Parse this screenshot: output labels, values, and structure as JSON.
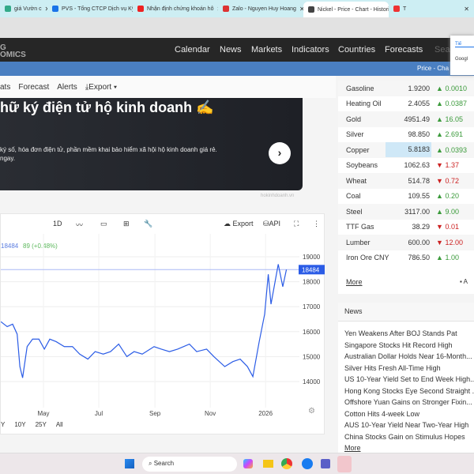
{
  "browser": {
    "tabs": [
      {
        "title": "giá Vườn c",
        "color": "#3a8"
      },
      {
        "title": "PVS - Tổng CTCP Dịch vụ Kỹ thu",
        "color": "#1a73e8"
      },
      {
        "title": "Nhận định chứng khoán hô",
        "color": "#e22"
      },
      {
        "title": "Zalo - Nguyen Huy Hoang",
        "color": "#d33"
      },
      {
        "title": "Nickel - Price - Chart - Historic",
        "color": "#444"
      },
      {
        "title": "T",
        "color": "#e33"
      }
    ]
  },
  "nav": {
    "logo_top": "G",
    "logo_bottom": "OMICS",
    "items": [
      "Calendar",
      "News",
      "Markets",
      "Indicators",
      "Countries",
      "Forecasts"
    ],
    "search_placeholder": "Sea"
  },
  "popup": {
    "tab": "Tiế",
    "text": "Googl"
  },
  "bluebar": {
    "text": "Price - Cha"
  },
  "subnav": {
    "items": [
      "ats",
      "Forecast",
      "Alerts"
    ],
    "export": "Export"
  },
  "ad": {
    "title": "hữ ký điện tử hộ kinh doanh ✍",
    "text_line1": "ký số, hóa đơn điện tử, phần mềm khai bảo hiểm xã hội hộ kinh doanh giá rẻ.",
    "text_line2": "ngay.",
    "source": "hokinhdoanh.vn"
  },
  "chart_toolbar": {
    "interval": "1D",
    "export": "Export",
    "api": "API"
  },
  "chart_data": {
    "type": "line",
    "price": "18484",
    "change": "89 (+0.48%)",
    "last_label": "18484",
    "ylim": [
      13200,
      19800
    ],
    "yticks": [
      19000,
      18000,
      17000,
      16000,
      15000,
      14000
    ],
    "xticks": [
      {
        "label": "May",
        "date": "2025-05-01"
      },
      {
        "label": "Jul",
        "date": "2025-07-01"
      },
      {
        "label": "Sep",
        "date": "2025-09-01"
      },
      {
        "label": "Nov",
        "date": "2025-11-01"
      },
      {
        "label": "2026",
        "date": "2026-01-01"
      }
    ],
    "series": [
      {
        "color": "#2b5ce6",
        "points": [
          [
            "2025-03-15",
            16400
          ],
          [
            "2025-03-22",
            16200
          ],
          [
            "2025-03-28",
            16300
          ],
          [
            "2025-04-02",
            15900
          ],
          [
            "2025-04-05",
            14600
          ],
          [
            "2025-04-08",
            14150
          ],
          [
            "2025-04-13",
            15400
          ],
          [
            "2025-04-19",
            15700
          ],
          [
            "2025-04-26",
            15700
          ],
          [
            "2025-05-02",
            15300
          ],
          [
            "2025-05-08",
            15700
          ],
          [
            "2025-05-15",
            15600
          ],
          [
            "2025-05-24",
            15400
          ],
          [
            "2025-06-02",
            15400
          ],
          [
            "2025-06-10",
            15100
          ],
          [
            "2025-06-19",
            14900
          ],
          [
            "2025-06-27",
            15200
          ],
          [
            "2025-07-06",
            15100
          ],
          [
            "2025-07-14",
            15200
          ],
          [
            "2025-07-23",
            15500
          ],
          [
            "2025-08-01",
            15000
          ],
          [
            "2025-08-09",
            15200
          ],
          [
            "2025-08-18",
            15100
          ],
          [
            "2025-08-31",
            15400
          ],
          [
            "2025-09-08",
            15300
          ],
          [
            "2025-09-17",
            15200
          ],
          [
            "2025-09-26",
            15300
          ],
          [
            "2025-10-09",
            15500
          ],
          [
            "2025-10-17",
            15200
          ],
          [
            "2025-10-28",
            15300
          ],
          [
            "2025-11-05",
            15000
          ],
          [
            "2025-11-17",
            14600
          ],
          [
            "2025-11-26",
            14800
          ],
          [
            "2025-12-04",
            14900
          ],
          [
            "2025-12-12",
            14600
          ],
          [
            "2025-12-18",
            14200
          ],
          [
            "2025-12-25",
            15600
          ],
          [
            "2025-12-31",
            16700
          ],
          [
            "2026-01-04",
            18300
          ],
          [
            "2026-01-07",
            17100
          ],
          [
            "2026-01-11",
            17900
          ],
          [
            "2026-01-15",
            18700
          ],
          [
            "2026-01-20",
            17800
          ],
          [
            "2026-01-24",
            18484
          ]
        ]
      }
    ],
    "ranges": [
      "Y",
      "10Y",
      "25Y",
      "All"
    ]
  },
  "commodities": [
    {
      "name": "Gasoline",
      "price": "1.9200",
      "change": "0.0010",
      "dir": "up"
    },
    {
      "name": "Heating Oil",
      "price": "2.4055",
      "change": "0.0387",
      "dir": "up"
    },
    {
      "name": "Gold",
      "price": "4951.49",
      "change": "16.05",
      "dir": "up"
    },
    {
      "name": "Silver",
      "price": "98.850",
      "change": "2.691",
      "dir": "up"
    },
    {
      "name": "Copper",
      "price": "5.8183",
      "change": "0.0393",
      "dir": "up"
    },
    {
      "name": "Soybeans",
      "price": "1062.63",
      "change": "1.37",
      "dir": "dn"
    },
    {
      "name": "Wheat",
      "price": "514.78",
      "change": "0.72",
      "dir": "dn"
    },
    {
      "name": "Coal",
      "price": "109.55",
      "change": "0.20",
      "dir": "up"
    },
    {
      "name": "Steel",
      "price": "3117.00",
      "change": "9.00",
      "dir": "up"
    },
    {
      "name": "TTF Gas",
      "price": "38.29",
      "change": "0.01",
      "dir": "dn"
    },
    {
      "name": "Lumber",
      "price": "600.00",
      "change": "12.00",
      "dir": "dn"
    },
    {
      "name": "Iron Ore CNY",
      "price": "786.50",
      "change": "1.00",
      "dir": "up"
    }
  ],
  "commodities_more": "More",
  "commodities_add": "A",
  "news": {
    "title": "News",
    "items": [
      "Yen Weakens After BOJ Stands Pat",
      "Singapore Stocks Hit Record High",
      "Australian Dollar Holds Near 16-Month...",
      "Silver Hits Fresh All-Time High",
      "US 10-Year Yield Set to End Week High...",
      "Hong Kong Stocks Eye Second Straight ...",
      "Offshore Yuan Gains on Stronger Fixin...",
      "Cotton Hits 4-week Low",
      "AUS 10-Year Yield Near Two-Year High",
      "China Stocks Gain on Stimulus Hopes"
    ],
    "more": "More"
  },
  "taskbar": {
    "search": "Search"
  }
}
